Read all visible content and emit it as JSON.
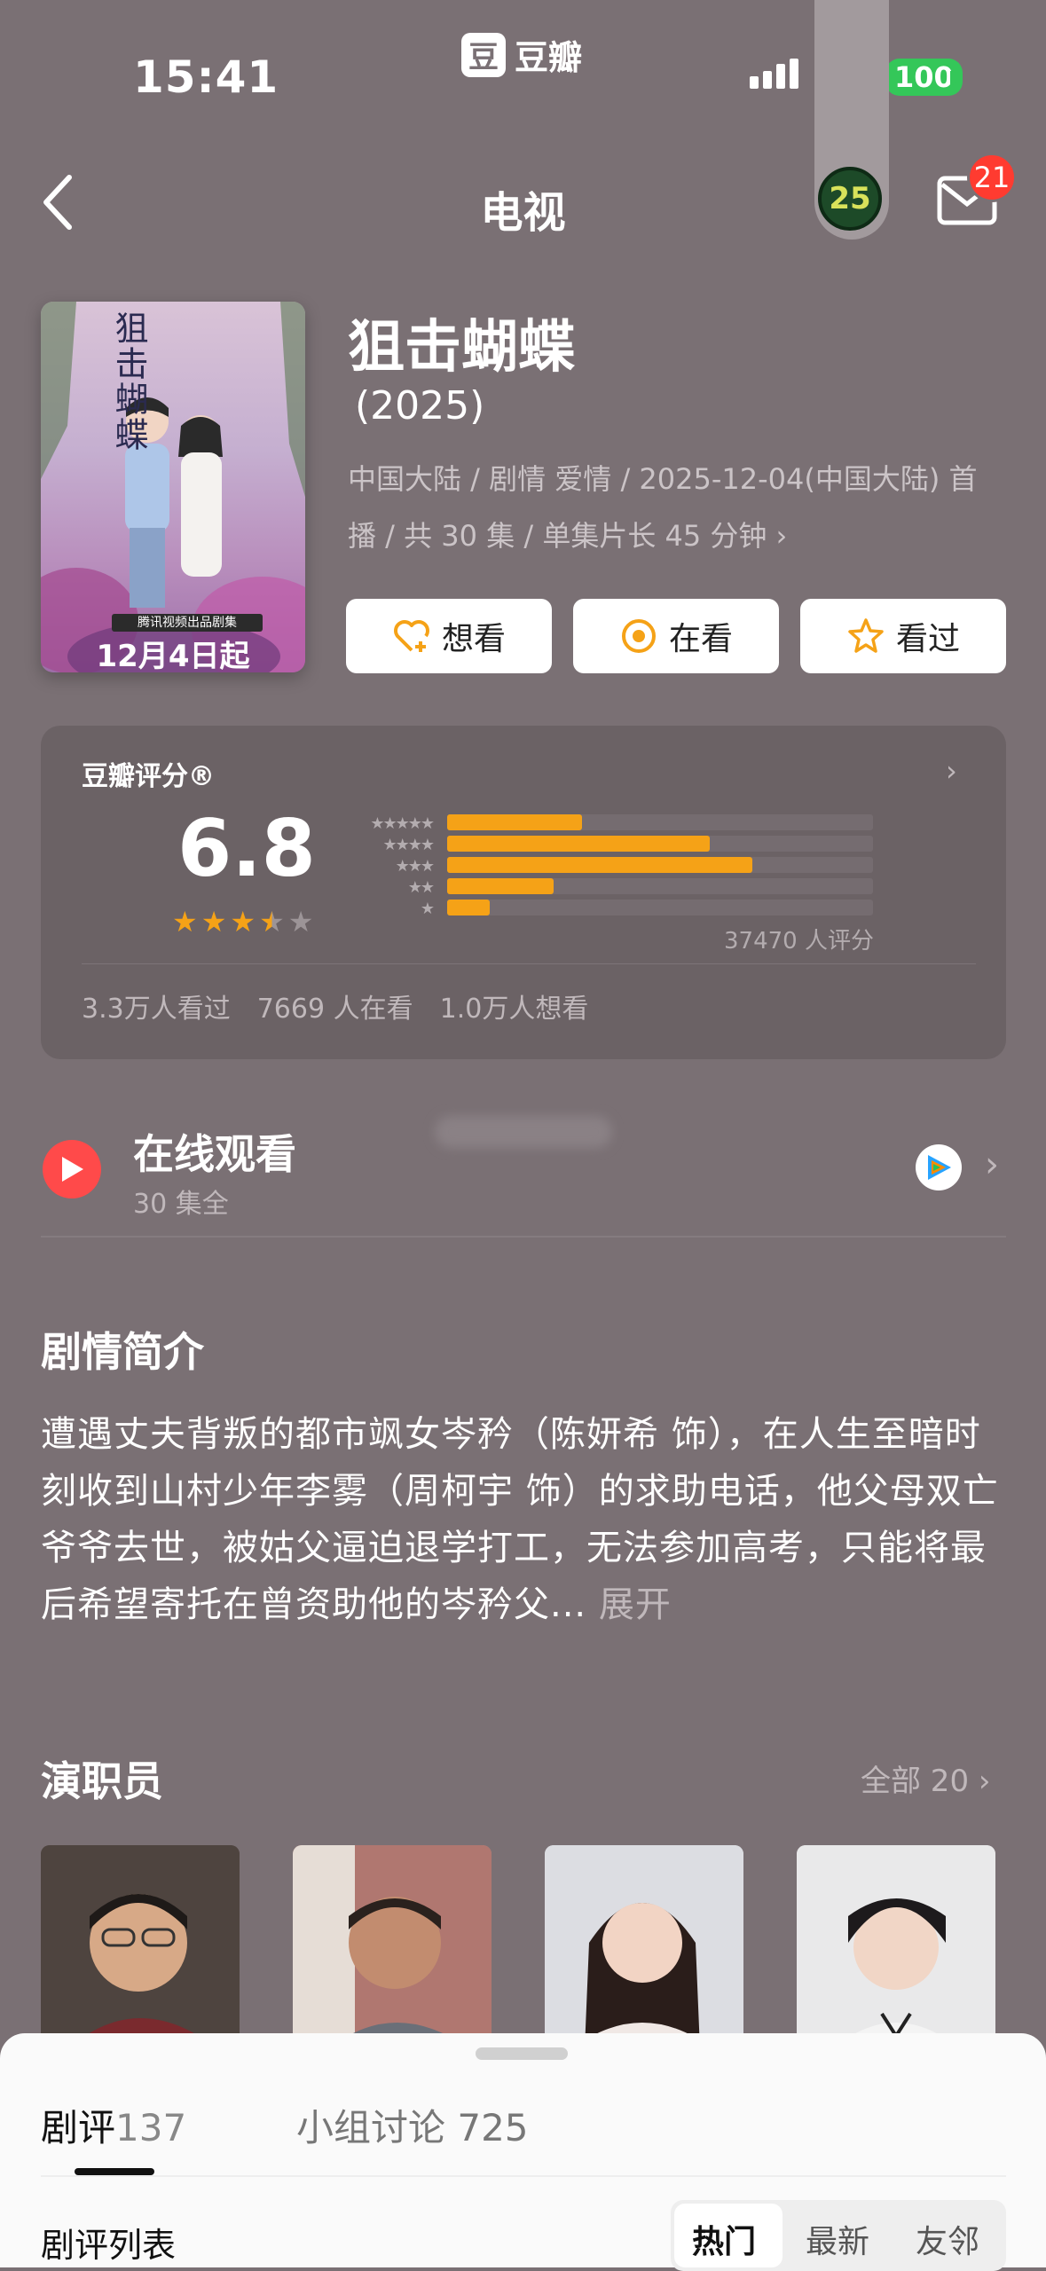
{
  "status": {
    "time": "15:41",
    "app": "豆瓣",
    "app_logo": "豆",
    "battery": "100"
  },
  "nav": {
    "title": "电视",
    "pill_badge": "25",
    "mail_count": "21"
  },
  "poster": {
    "title": "狙击蝴蝶",
    "band": "腾讯视频出品剧集",
    "date": "12月4日起"
  },
  "show": {
    "title": "狙击蝴蝶",
    "year": "(2025)",
    "meta": "中国大陆 / 剧情 爱情 / 2025-12-04(中国大陆) 首播 / 共 30 集 / 单集片长 45 分钟 ›"
  },
  "actions": {
    "want": "想看",
    "watching": "在看",
    "watched": "看过"
  },
  "rating": {
    "label": "豆瓣评分®",
    "score": "6.8",
    "stars": 3.5,
    "distribution": [
      0.095,
      0.185,
      0.215,
      0.075,
      0.03
    ],
    "count": "37470 人评分",
    "watched": "3.3万人看过",
    "watching": "7669 人在看",
    "want": "1.0万人想看"
  },
  "online": {
    "title": "在线观看",
    "subtitle": "30 集全"
  },
  "synopsis": {
    "title": "剧情简介",
    "text": "遭遇丈夫背叛的都市飒女岑矜（陈妍希 饰），在人生至暗时刻收到山村少年李雾（周柯宇 饰）的求助电话，他父母双亡爷爷去世，被姑父逼迫退学打工，无法参加高考，只能将最后希望寄托在曾资助他的岑矜父...",
    "more": "展开"
  },
  "cast": {
    "title": "演职员",
    "all": "全部 20 ›"
  },
  "sheet": {
    "tab_reviews": "剧评",
    "tab_reviews_count": "137",
    "tab_groups": "小组讨论 725",
    "list_title": "剧评列表",
    "filters": [
      "热门",
      "最新",
      "友邻"
    ]
  },
  "colors": {
    "background": "#7a7074",
    "accent": "#f5a217",
    "play": "#ff4a4a",
    "badge": "#ff3b30"
  }
}
